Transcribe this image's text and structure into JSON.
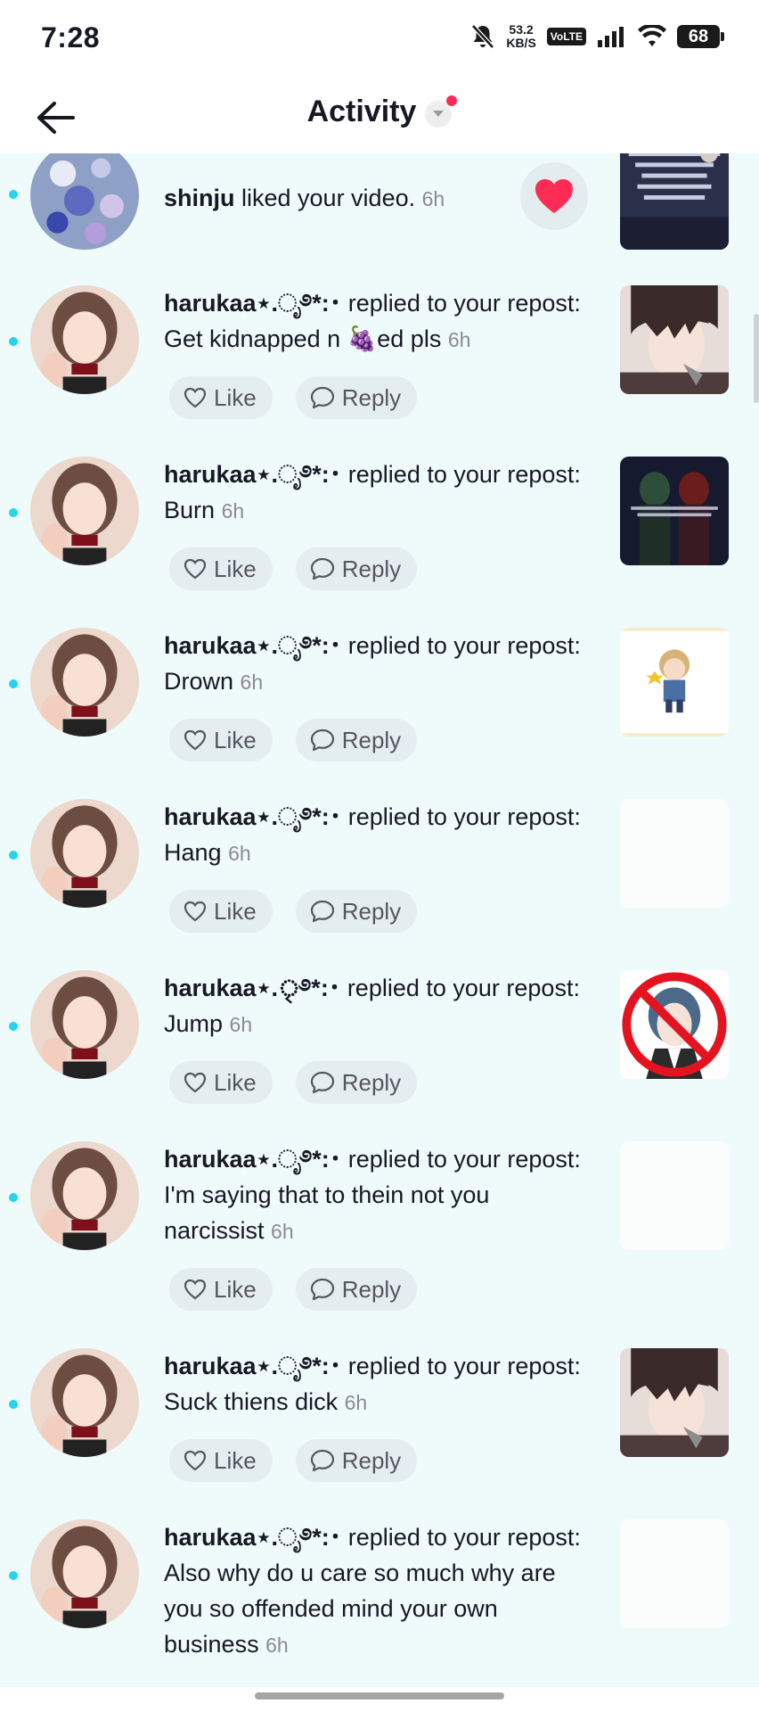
{
  "status_bar": {
    "time": "7:28",
    "net_speed_value": "53.2",
    "net_speed_unit": "KB/S",
    "volte": "VoLTE",
    "battery": "68"
  },
  "header": {
    "title": "Activity"
  },
  "actions": {
    "like": "Like",
    "reply": "Reply"
  },
  "notifications": [
    {
      "user": "shinju",
      "action": " liked your video.",
      "message": "",
      "time": "6h",
      "unread": true,
      "thumb_icon": "video-thumb-text-icon"
    },
    {
      "user": "harukaa⋆.ೃ࿔*:･",
      "action": " replied to your repost: ",
      "message": "Get kidnapped n 🍇ed pls",
      "time": "6h",
      "unread": true,
      "thumb_icon": "anime-man-thumb-icon"
    },
    {
      "user": "harukaa⋆.ೃ࿔*:･",
      "action": " replied to your repost: ",
      "message": "Burn",
      "time": "6h",
      "unread": true,
      "thumb_icon": "dark-video-thumb-icon"
    },
    {
      "user": "harukaa⋆.ೃ࿔*:･",
      "action": " replied to your repost: ",
      "message": "Drown",
      "time": "6h",
      "unread": true,
      "thumb_icon": "chibi-character-thumb-icon"
    },
    {
      "user": "harukaa⋆.ೃ࿔*:･",
      "action": " replied to your repost: ",
      "message": "Hang",
      "time": "6h",
      "unread": true,
      "thumb_icon": "blank-thumb-icon"
    },
    {
      "user": "harukaa⋆.ৃ࿔*:･",
      "action": " replied to your repost: ",
      "message": "Jump",
      "time": "6h",
      "unread": true,
      "thumb_icon": "prohibited-character-thumb-icon"
    },
    {
      "user": "harukaa⋆.ೃ࿔*:･",
      "action": " replied to your repost: ",
      "message": "I'm saying that to thein not you narcissist",
      "time": "6h",
      "unread": true,
      "thumb_icon": "blank-thumb-icon"
    },
    {
      "user": "harukaa⋆.ೃ࿔*:･",
      "action": " replied to your repost: ",
      "message": "Suck thiens dick",
      "time": "6h",
      "unread": true,
      "thumb_icon": "anime-man-thumb-icon"
    },
    {
      "user": "harukaa⋆.ೃ࿔*:･",
      "action": " replied to your repost: ",
      "message": "Also why do u care so much why are you so offended mind your own business",
      "time": "6h",
      "unread": true,
      "thumb_icon": "blank-thumb-icon"
    }
  ]
}
